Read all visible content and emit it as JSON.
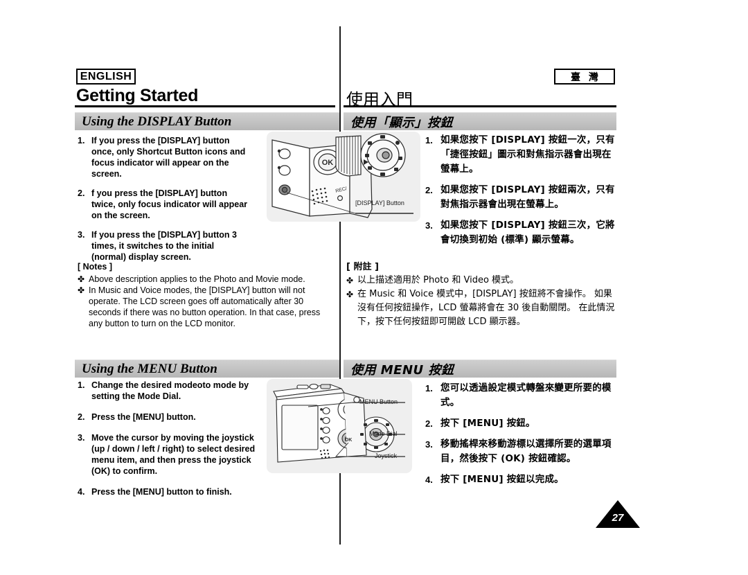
{
  "page": {
    "number": "27",
    "lang_badge_en": "ENGLISH",
    "lang_badge_zh": "臺 灣",
    "chapter_title_en": "Getting Started",
    "chapter_title_zh": "使用入門"
  },
  "display_section": {
    "heading_en": "Using the DISPLAY Button",
    "heading_zh": "使用「顯示」按鈕",
    "steps_en": [
      {
        "num": "1.",
        "text": "If you press the [DISPLAY] button once, only Shortcut Button icons and focus indicator will appear on the screen."
      },
      {
        "num": "2.",
        "text": "f you press the [DISPLAY] button twice, only focus indicator will appear on the screen."
      },
      {
        "num": "3.",
        "text": "If you press the [DISPLAY] button 3 times, it switches to the initial (normal) display screen."
      }
    ],
    "steps_zh": [
      {
        "num": "1.",
        "text": "如果您按下 [DISPLAY] 按鈕一次，只有「捷徑按鈕」圖示和對焦指示器會出現在螢幕上。"
      },
      {
        "num": "2.",
        "text": "如果您按下 [DISPLAY] 按鈕兩次，只有對焦指示器會出現在螢幕上。"
      },
      {
        "num": "3.",
        "text": "如果您按下 [DISPLAY] 按鈕三次，它將會切換到初始 (標準) 顯示螢幕。"
      }
    ],
    "notes_title_en": "[ Notes ]",
    "notes_title_zh": "[ 附註 ]",
    "notes_en": [
      "Above description applies to the Photo and Movie mode.",
      "In Music and Voice modes, the [DISPLAY] button will not operate. The LCD screen goes off automatically after 30 seconds if there was no button operation. In that case, press any button to turn on the LCD monitor."
    ],
    "notes_zh": [
      "以上描述適用於 Photo 和 Video 模式。",
      "在 Music 和 Voice 模式中，[DISPLAY] 按鈕將不會操作。 如果沒有任何按鈕操作，LCD 螢幕將會在 30 後自動關閉。 在此情況下，按下任何按鈕即可開啟 LCD 顯示器。"
    ],
    "illustration_callouts": [
      "[DISPLAY] Button"
    ],
    "illustration_markings": [
      "OK",
      "REC/"
    ]
  },
  "menu_section": {
    "heading_en": "Using the MENU Button",
    "heading_zh": "使用 MENU 按鈕",
    "steps_en": [
      {
        "num": "1.",
        "text": "Change the desired modeoto mode by setting the Mode Dial."
      },
      {
        "num": "2.",
        "text": "Press the [MENU] button."
      },
      {
        "num": "3.",
        "text": "Move the cursor by moving the joystick (up / down / left / right) to select desired menu item, and then press the joystick (OK) to confirm."
      },
      {
        "num": "4.",
        "text": "Press the [MENU] button to finish."
      }
    ],
    "steps_zh": [
      {
        "num": "1.",
        "text": "您可以透過設定模式轉盤來變更所要的模式。"
      },
      {
        "num": "2.",
        "text": "按下 [MENU] 按鈕。"
      },
      {
        "num": "3.",
        "text": "移動搖桿來移動游標以選擇所要的選單項目，然後按下 (OK) 按鈕確認。"
      },
      {
        "num": "4.",
        "text": "按下 [MENU] 按鈕以完成。"
      }
    ],
    "illustration_callouts": [
      "MENU Button",
      "Mode Dial",
      "Joystick"
    ],
    "illustration_markings": [
      "OK"
    ]
  },
  "bullet_glyph": "✤",
  "colors": {
    "section_bar": "#c2c2c2",
    "illustration_panel": "#efefef",
    "rule": "#000000",
    "page_badge": "#000000"
  }
}
